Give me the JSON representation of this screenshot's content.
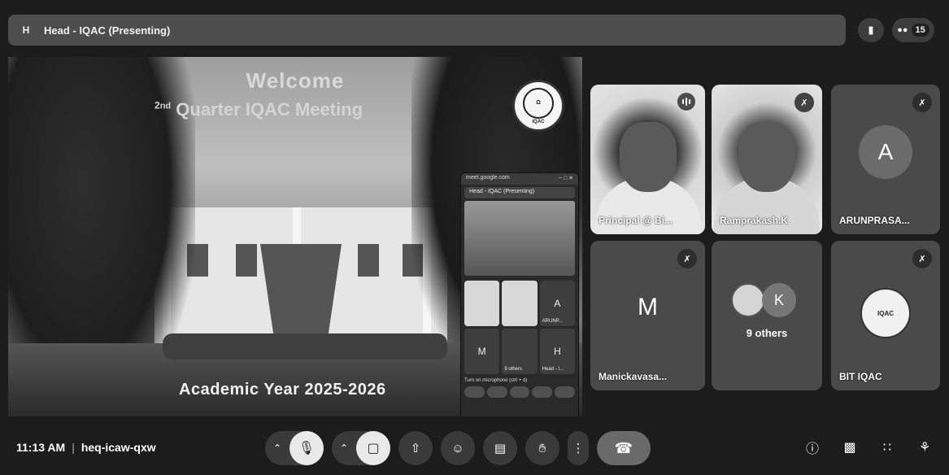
{
  "topbar": {
    "badge": "H",
    "title": "Head - IQAC (Presenting)",
    "participant_count": "15"
  },
  "slide": {
    "welcome": "Welcome",
    "quarter_sup": "2",
    "quarter_rest": "Quarter IQAC Meeting",
    "academic_year": "Academic Year 2025-2026",
    "seal_label": "IQAC"
  },
  "mini_window": {
    "url": "meet.google.com",
    "title": "Head - IQAC (Presenting)",
    "tiles": [
      {
        "label": "",
        "type": "face"
      },
      {
        "label": "",
        "type": "face"
      },
      {
        "label": "A",
        "small": "ARUNP..."
      },
      {
        "label": "M",
        "small": ""
      },
      {
        "label": "",
        "small": "9 others"
      },
      {
        "label": "H",
        "small": "Head - I..."
      }
    ],
    "tip": "Turn on microphone (ctrl + d)"
  },
  "tiles": [
    {
      "name": "Principal @ Bi...",
      "status": "speaking"
    },
    {
      "name": "Ramprakash.K",
      "status": "muted"
    },
    {
      "name": "ARUNPRASA...",
      "letter": "A",
      "status": "muted"
    },
    {
      "name": "Manickavasa...",
      "letter": "M",
      "status": "muted"
    },
    {
      "name": "9 others",
      "letter": "K"
    },
    {
      "name": "BIT IQAC",
      "status": "muted",
      "seal": "IQAC"
    }
  ],
  "bottombar": {
    "time": "11:13 AM",
    "meeting_code": "heq-icaw-qxw"
  },
  "icons": {
    "mic_off": "mic-off-icon",
    "cam_off": "camera-off-icon",
    "present": "present-icon",
    "emoji": "emoji-icon",
    "captions": "captions-icon",
    "hand": "raise-hand-icon",
    "more": "more-options-icon",
    "end": "end-call-icon",
    "info": "info-icon",
    "chat": "chat-icon",
    "activities": "activities-icon",
    "lock": "host-controls-icon"
  }
}
